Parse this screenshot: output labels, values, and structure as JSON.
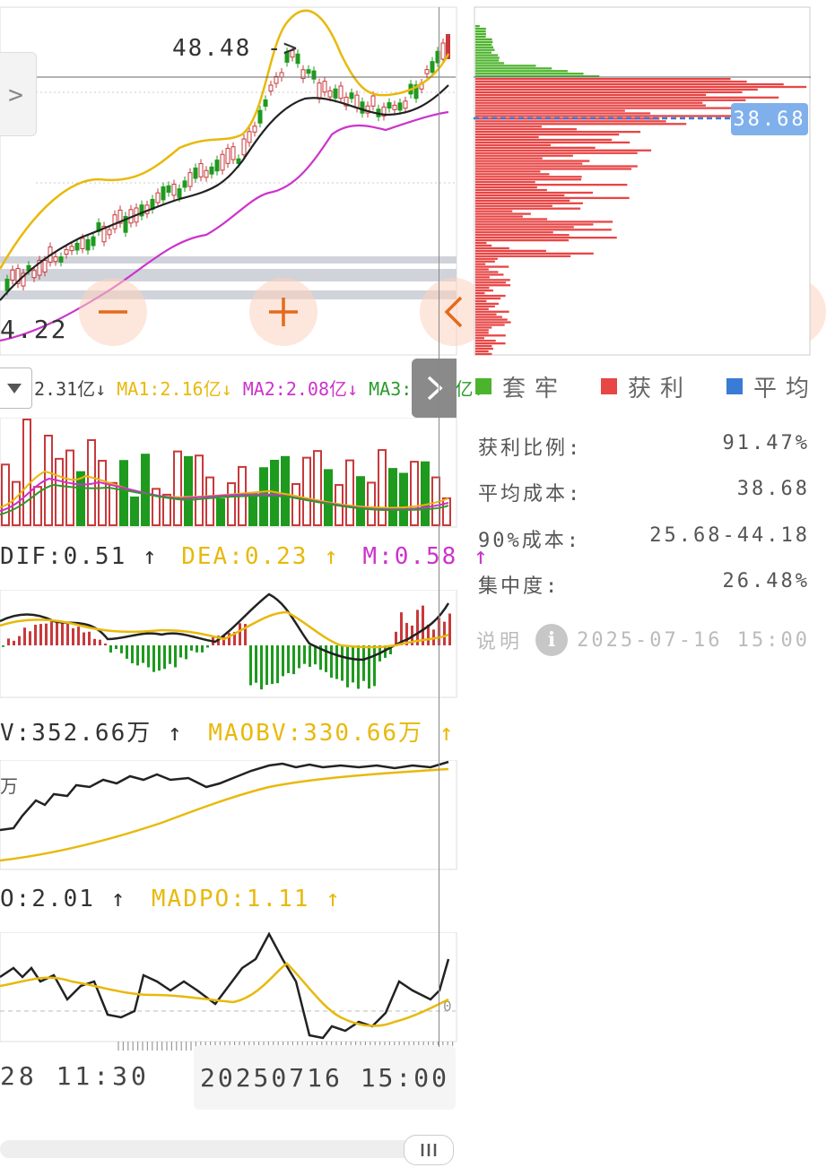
{
  "kline": {
    "high_price_label": "48.48 ->",
    "low_price_label": "4.22",
    "nav_prev_label": ">"
  },
  "volume": {
    "dropdown_icon": "triangle-down-icon",
    "vol": "2.31亿↓",
    "ma1": "MA1:2.16亿↓",
    "ma2": "MA2:2.08亿↓",
    "ma3": "MA3:2.07亿↓",
    "colors": {
      "ma1": "#e8b90c",
      "ma2": "#cc33cc",
      "ma3": "#2c9a2c"
    }
  },
  "macd": {
    "dif": "DIF:0.51 ↑",
    "dea": "DEA:0.23 ↑",
    "m": "M:0.58 ↑"
  },
  "obv": {
    "obv": "V:352.66万 ↑",
    "maobv": "MAOBV:330.66万 ↑",
    "axis_label": "万"
  },
  "dpo": {
    "dpo": "O:2.01 ↑",
    "madpo": "MADPO:1.11 ↑",
    "axis_label": "0"
  },
  "time_axis": {
    "left_label": "28 11:30",
    "cursor_label": "20250716 15:00"
  },
  "chips": {
    "avg_price_tag": "38.68",
    "legend": {
      "trapped": "套牢",
      "profit": "获利",
      "average": "平均"
    },
    "stats": [
      {
        "label": "获利比例:",
        "value": "91.47%"
      },
      {
        "label": "平均成本:",
        "value": "38.68"
      },
      {
        "label": "90%成本:",
        "value": "25.68-44.18"
      },
      {
        "label": "集中度:",
        "value": "26.48%"
      }
    ],
    "note_label": "说明",
    "timestamp": "2025-07-16 15:00"
  },
  "colors": {
    "up": "#c8393b",
    "down": "#1e9a1e",
    "boll": "#e8b90c",
    "ma_mid": "#222222",
    "ma_slow": "#cc33cc",
    "profit": "#e84545",
    "trapped": "#4cb32c",
    "average": "#3a7bd5",
    "accent_btn": "#e36a1c"
  }
}
